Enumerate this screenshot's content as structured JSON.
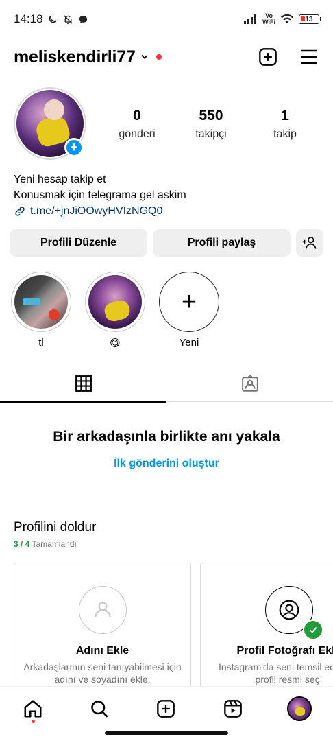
{
  "status_bar": {
    "time": "14:18",
    "vowifi_top": "Vo",
    "vowifi_bottom": "WiFi",
    "battery": "13"
  },
  "header": {
    "username": "meliskendirli77"
  },
  "profile": {
    "stats": [
      {
        "value": "0",
        "label": "gönderi"
      },
      {
        "value": "550",
        "label": "takipçi"
      },
      {
        "value": "1",
        "label": "takip"
      }
    ],
    "bio_line1": "Yeni hesap takip et",
    "bio_line2": "Konusmak için telegrama gel askim",
    "bio_link": "t.me/+jnJiOOwyHVIzNGQ0"
  },
  "buttons": {
    "edit": "Profili Düzenle",
    "share": "Profili paylaş"
  },
  "highlights": [
    {
      "label": "tl"
    },
    {
      "label": "😋"
    },
    {
      "label": "Yeni"
    }
  ],
  "empty_state": {
    "title": "Bir arkadaşınla birlikte anı yakala",
    "link": "İlk gönderini oluştur"
  },
  "complete_profile": {
    "title": "Profilini doldur",
    "progress": "3 / 4",
    "progress_suffix": "Tamamlandı",
    "cards": [
      {
        "title": "Adını Ekle",
        "desc": "Arkadaşlarının seni tanıyabilmesi için adını ve soyadını ekle."
      },
      {
        "title": "Profil Fotoğrafı Ekle",
        "desc": "Instagram'da seni temsil eden bir profil resmi seç."
      }
    ]
  },
  "colors": {
    "accent": "#0095f6",
    "notify": "#ff3040",
    "success": "#1f9d3a",
    "button_bg": "#efefef"
  },
  "nav": {
    "items": [
      "home-icon",
      "search-icon",
      "create-icon",
      "reels-icon",
      "profile-avatar"
    ]
  }
}
